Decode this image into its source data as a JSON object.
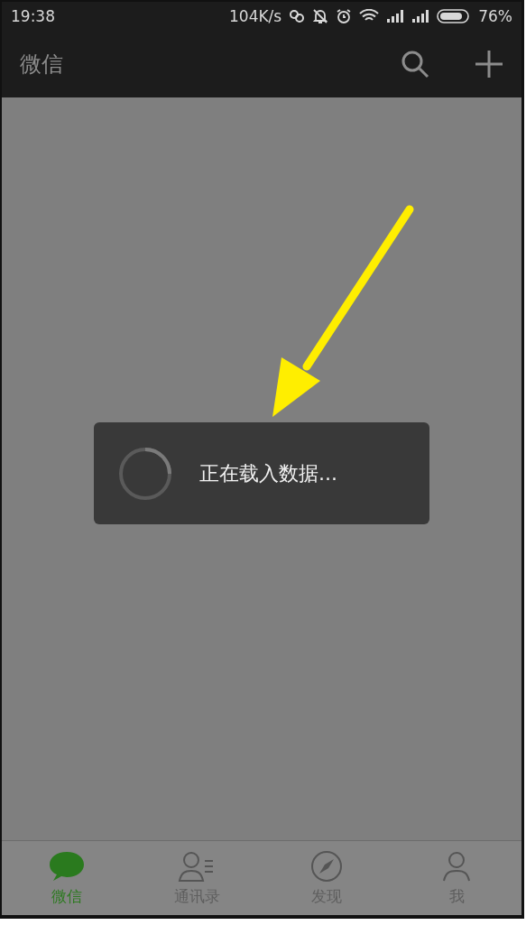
{
  "status_bar": {
    "time": "19:38",
    "network_speed": "104K/s",
    "battery": "76%"
  },
  "app_bar": {
    "title": "微信"
  },
  "loading": {
    "text": "正在载入数据..."
  },
  "tabs": [
    {
      "label": "微信",
      "kind": "chat",
      "selected": true
    },
    {
      "label": "通讯录",
      "kind": "contacts",
      "selected": false
    },
    {
      "label": "发现",
      "kind": "discover",
      "selected": false
    },
    {
      "label": "我",
      "kind": "me",
      "selected": false
    }
  ]
}
